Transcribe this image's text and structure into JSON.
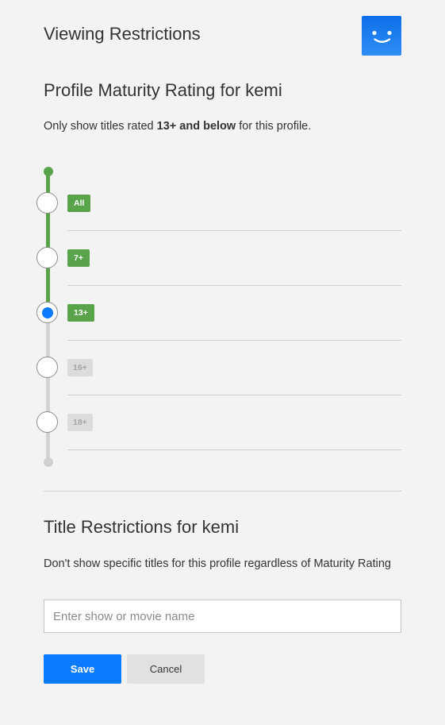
{
  "header": {
    "title": "Viewing Restrictions",
    "avatar_icon": "smiley-face-icon",
    "avatar_color": "#0b6fe8"
  },
  "maturity": {
    "heading": "Profile Maturity Rating for kemi",
    "desc_prefix": "Only show titles rated ",
    "desc_bold": "13+ and below",
    "desc_suffix": " for this profile.",
    "selected": "13+",
    "levels": [
      {
        "label": "All",
        "active": true,
        "selected": false
      },
      {
        "label": "7+",
        "active": true,
        "selected": false
      },
      {
        "label": "13+",
        "active": true,
        "selected": true
      },
      {
        "label": "16+",
        "active": false,
        "selected": false
      },
      {
        "label": "18+",
        "active": false,
        "selected": false
      }
    ],
    "active_color": "#59a34a",
    "selected_color": "#0a7aff"
  },
  "title_restrictions": {
    "heading": "Title Restrictions for kemi",
    "desc": "Don't show specific titles for this profile regardless of Maturity Rating",
    "input_value": "",
    "input_placeholder": "Enter show or movie name"
  },
  "actions": {
    "save_label": "Save",
    "cancel_label": "Cancel",
    "save_color": "#0a7aff"
  }
}
